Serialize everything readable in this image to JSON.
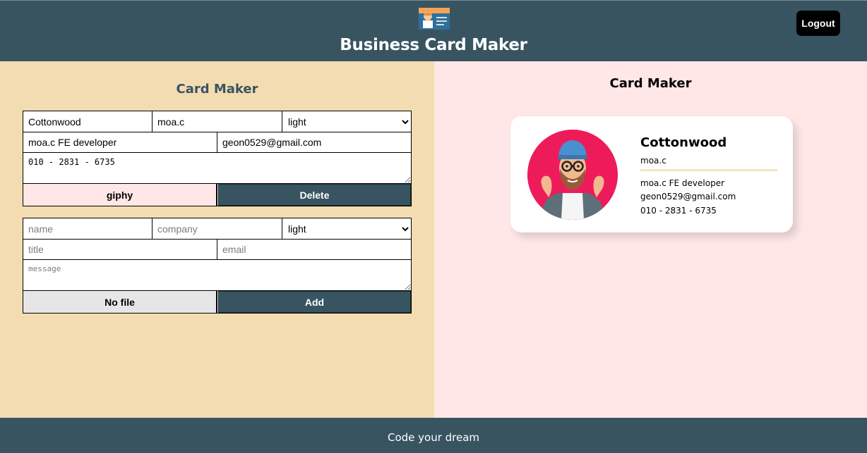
{
  "header": {
    "logo_icon": "business-card-logo-icon",
    "title": "Business Card Maker",
    "logout_label": "Logout"
  },
  "maker": {
    "title": "Card Maker",
    "cards": [
      {
        "name": "Cottonwood",
        "company": "moa.c",
        "theme": "light",
        "title": "moa.c FE developer",
        "email": "geon0529@gmail.com",
        "message": "010 - 2831 - 6735",
        "file_label": "giphy",
        "action_label": "Delete"
      }
    ],
    "add_form": {
      "name_placeholder": "name",
      "company_placeholder": "company",
      "theme": "light",
      "title_placeholder": "title",
      "email_placeholder": "email",
      "message_placeholder": "message",
      "file_label": "No file",
      "action_label": "Add"
    },
    "theme_options": [
      "light"
    ]
  },
  "preview": {
    "title": "Card Maker",
    "card": {
      "avatar_icon": "bearded-man-avatar-icon",
      "name": "Cottonwood",
      "company": "moa.c",
      "title": "moa.c FE developer",
      "email": "geon0529@gmail.com",
      "message": "010 - 2831 - 6735"
    }
  },
  "footer": {
    "text": "Code your dream"
  },
  "colors": {
    "header_bg": "#385461",
    "maker_bg": "#f4dcb2",
    "preview_bg": "#ffe7e7",
    "avatar_bg": "#ee1b5b",
    "action_button_bg": "#385461"
  }
}
